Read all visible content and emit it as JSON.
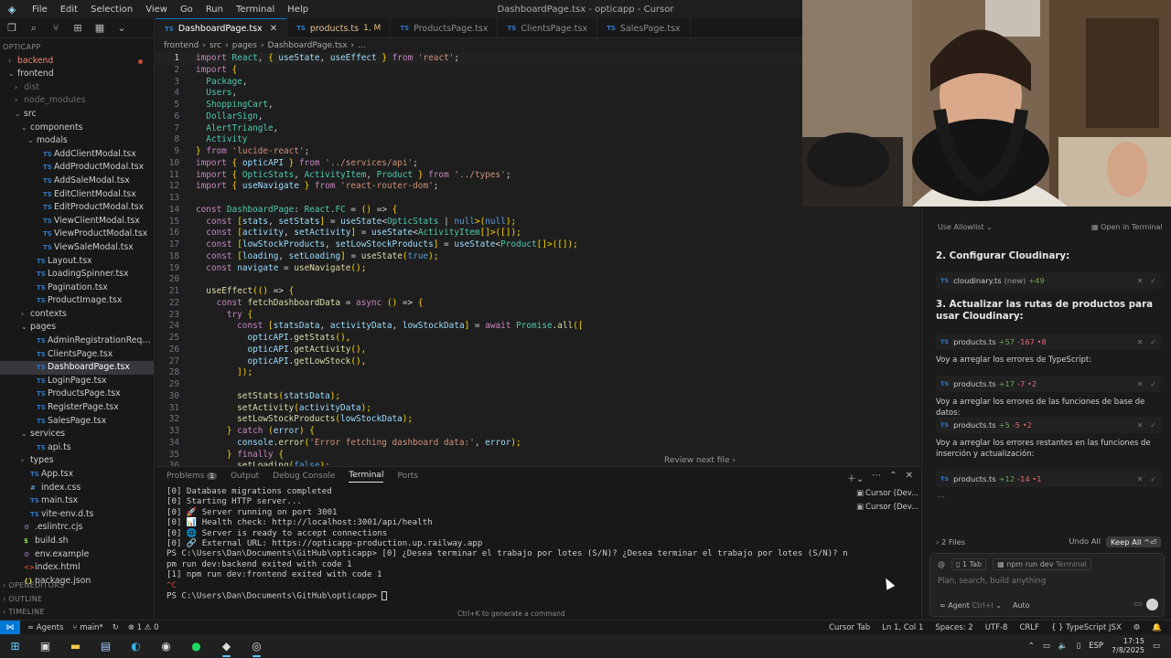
{
  "window": {
    "title": "DashboardPage.tsx - opticapp - Cursor",
    "menu": [
      "File",
      "Edit",
      "Selection",
      "View",
      "Go",
      "Run",
      "Terminal",
      "Help"
    ]
  },
  "explorer": {
    "items": [
      {
        "label": "OPTICAPP",
        "depth": 0,
        "type": "section"
      },
      {
        "label": "backend",
        "depth": 1,
        "type": "folder-closed",
        "state": "red"
      },
      {
        "label": "frontend",
        "depth": 1,
        "type": "folder-open"
      },
      {
        "label": "dist",
        "depth": 2,
        "type": "folder-closed",
        "state": "muted"
      },
      {
        "label": "node_modules",
        "depth": 2,
        "type": "folder-closed",
        "state": "muted"
      },
      {
        "label": "src",
        "depth": 2,
        "type": "folder-open"
      },
      {
        "label": "components",
        "depth": 3,
        "type": "folder-open"
      },
      {
        "label": "modals",
        "depth": 4,
        "type": "folder-open"
      },
      {
        "label": "AddClientModal.tsx",
        "depth": 5,
        "type": "tsx"
      },
      {
        "label": "AddProductModal.tsx",
        "depth": 5,
        "type": "tsx"
      },
      {
        "label": "AddSaleModal.tsx",
        "depth": 5,
        "type": "tsx"
      },
      {
        "label": "EditClientModal.tsx",
        "depth": 5,
        "type": "tsx"
      },
      {
        "label": "EditProductModal.tsx",
        "depth": 5,
        "type": "tsx"
      },
      {
        "label": "ViewClientModal.tsx",
        "depth": 5,
        "type": "tsx"
      },
      {
        "label": "ViewProductModal.tsx",
        "depth": 5,
        "type": "tsx"
      },
      {
        "label": "ViewSaleModal.tsx",
        "depth": 5,
        "type": "tsx"
      },
      {
        "label": "Layout.tsx",
        "depth": 4,
        "type": "tsx"
      },
      {
        "label": "LoadingSpinner.tsx",
        "depth": 4,
        "type": "tsx"
      },
      {
        "label": "Pagination.tsx",
        "depth": 4,
        "type": "tsx"
      },
      {
        "label": "ProductImage.tsx",
        "depth": 4,
        "type": "tsx"
      },
      {
        "label": "contexts",
        "depth": 3,
        "type": "folder-closed"
      },
      {
        "label": "pages",
        "depth": 3,
        "type": "folder-open"
      },
      {
        "label": "AdminRegistrationRequestsPag...",
        "depth": 4,
        "type": "tsx"
      },
      {
        "label": "ClientsPage.tsx",
        "depth": 4,
        "type": "tsx"
      },
      {
        "label": "DashboardPage.tsx",
        "depth": 4,
        "type": "tsx",
        "state": "active"
      },
      {
        "label": "LoginPage.tsx",
        "depth": 4,
        "type": "tsx"
      },
      {
        "label": "ProductsPage.tsx",
        "depth": 4,
        "type": "tsx"
      },
      {
        "label": "RegisterPage.tsx",
        "depth": 4,
        "type": "tsx"
      },
      {
        "label": "SalesPage.tsx",
        "depth": 4,
        "type": "tsx"
      },
      {
        "label": "services",
        "depth": 3,
        "type": "folder-open"
      },
      {
        "label": "api.ts",
        "depth": 4,
        "type": "ts"
      },
      {
        "label": "types",
        "depth": 3,
        "type": "folder-closed"
      },
      {
        "label": "App.tsx",
        "depth": 3,
        "type": "tsx"
      },
      {
        "label": "index.css",
        "depth": 3,
        "type": "css"
      },
      {
        "label": "main.tsx",
        "depth": 3,
        "type": "tsx"
      },
      {
        "label": "vite-env.d.ts",
        "depth": 3,
        "type": "ts"
      },
      {
        "label": ".eslintrc.cjs",
        "depth": 2,
        "type": "cfg"
      },
      {
        "label": "build.sh",
        "depth": 2,
        "type": "sh"
      },
      {
        "label": "env.example",
        "depth": 2,
        "type": "cfg"
      },
      {
        "label": "index.html",
        "depth": 2,
        "type": "html"
      },
      {
        "label": "package.json",
        "depth": 2,
        "type": "json"
      }
    ],
    "footer_sections": [
      "OPENEDITORS",
      "OUTLINE",
      "TIMELINE"
    ]
  },
  "tabs": [
    {
      "label": "DashboardPage.tsx",
      "active": true
    },
    {
      "label": "products.ts",
      "marker": "1, M",
      "modified": true
    },
    {
      "label": "ProductsPage.tsx"
    },
    {
      "label": "ClientsPage.tsx"
    },
    {
      "label": "SalesPage.tsx"
    }
  ],
  "breadcrumb": [
    "frontend",
    "src",
    "pages",
    "DashboardPage.tsx",
    "..."
  ],
  "code": {
    "current_line": 1,
    "lines": [
      "import React, { useState, useEffect } from 'react';",
      "import {",
      "  Package,",
      "  Users,",
      "  ShoppingCart,",
      "  DollarSign,",
      "  AlertTriangle,",
      "  Activity",
      "} from 'lucide-react';",
      "import { opticAPI } from '../services/api';",
      "import { OpticStats, ActivityItem, Product } from '../types';",
      "import { useNavigate } from 'react-router-dom';",
      "",
      "const DashboardPage: React.FC = () => {",
      "  const [stats, setStats] = useState<OpticStats | null>(null);",
      "  const [activity, setActivity] = useState<ActivityItem[]>([]);",
      "  const [lowStockProducts, setLowStockProducts] = useState<Product[]>([]);",
      "  const [loading, setLoading] = useState(true);",
      "  const navigate = useNavigate();",
      "",
      "  useEffect(() => {",
      "    const fetchDashboardData = async () => {",
      "      try {",
      "        const [statsData, activityData, lowStockData] = await Promise.all([",
      "          opticAPI.getStats(),",
      "          opticAPI.getActivity(),",
      "          opticAPI.getLowStock(),",
      "        ]);",
      "",
      "        setStats(statsData);",
      "        setActivity(activityData);",
      "        setLowStockProducts(lowStockData);",
      "      } catch (error) {",
      "        console.error('Error fetching dashboard data:', error);",
      "      } finally {",
      "        setLoading(false);"
    ]
  },
  "review_next": "Review next file",
  "panel": {
    "tabs": [
      {
        "label": "Problems",
        "badge": "1"
      },
      {
        "label": "Output"
      },
      {
        "label": "Debug Console"
      },
      {
        "label": "Terminal",
        "active": true
      },
      {
        "label": "Ports"
      }
    ],
    "terminal_lines": [
      "[0] Database migrations completed",
      "[0] Starting HTTP server...",
      "[0] 🚀 Server running on port 3001",
      "[0] 📊 Health check: http://localhost:3001/api/health",
      "[0] 🌐 Server is ready to accept connections",
      "[0] 🔗 External URL: https://opticapp-production.up.railway.app",
      "PS C:\\Users\\Dan\\Documents\\GitHub\\opticapp> [0] ¿Desea terminar el trabajo por lotes (S/N)? ¿Desea terminar el trabajo por lotes (S/N)? npm run dev:backend exited with code 1",
      "[1] npm run dev:frontend exited with code 1",
      "^C",
      "PS C:\\Users\\Dan\\Documents\\GitHub\\opticapp> "
    ],
    "terminal_instances": [
      "Cursor (Dev...",
      "Cursor (Dev..."
    ],
    "hint": "Ctrl+K to generate a command"
  },
  "agent": {
    "allowlist": "Use Allowlist",
    "open_terminal": "Open in Terminal",
    "blocks": [
      {
        "kind": "heading",
        "text": "2. Configurar Cloudinary:"
      },
      {
        "kind": "file",
        "name": "cloudinary.ts",
        "note": "(new)",
        "plus": "+49",
        "minus": ""
      },
      {
        "kind": "heading",
        "text": "3. Actualizar las rutas de productos para usar Cloudinary:"
      },
      {
        "kind": "file",
        "name": "products.ts",
        "plus": "+57",
        "minus": "-167 •8"
      },
      {
        "kind": "text",
        "text": "Voy a arreglar los errores de TypeScript:"
      },
      {
        "kind": "file",
        "name": "products.ts",
        "plus": "+17",
        "minus": "-7 •2"
      },
      {
        "kind": "text",
        "text": "Voy a arreglar los errores de las funciones de base de datos:"
      },
      {
        "kind": "file",
        "name": "products.ts",
        "plus": "+5",
        "minus": "-5 •2"
      },
      {
        "kind": "text",
        "text": "Voy a arreglar los errores restantes en las funciones de inserción y actualización:"
      },
      {
        "kind": "file",
        "name": "products.ts",
        "plus": "+12",
        "minus": "-14 •1"
      }
    ],
    "ellipsis": "...",
    "files_count": "2 Files",
    "undo_all": "Undo All",
    "keep_all": "Keep All ^⏎",
    "ctx_tab": "1 Tab",
    "ctx_term": "npm run dev",
    "ctx_term_tag": "Terminal",
    "placeholder": "Plan, search, build anything",
    "mode": "Agent",
    "mode_shortcut": "Ctrl+I",
    "model": "Auto"
  },
  "statusbar": {
    "agents": "Agents",
    "branch": "main*",
    "problems": "⊗ 1 ⚠ 0",
    "cursor_tab": "Cursor Tab",
    "position": "Ln 1, Col 1",
    "spaces": "Spaces: 2",
    "encoding": "UTF-8",
    "eol": "CRLF",
    "language": "TypeScript JSX"
  },
  "taskbar": {
    "lang": "ESP",
    "time": "17:15",
    "date": "7/8/2025"
  },
  "colors": {
    "accent": "#0078d4",
    "ts_blue": "#3178c6",
    "added": "#6aa84f",
    "removed": "#e06c75"
  }
}
